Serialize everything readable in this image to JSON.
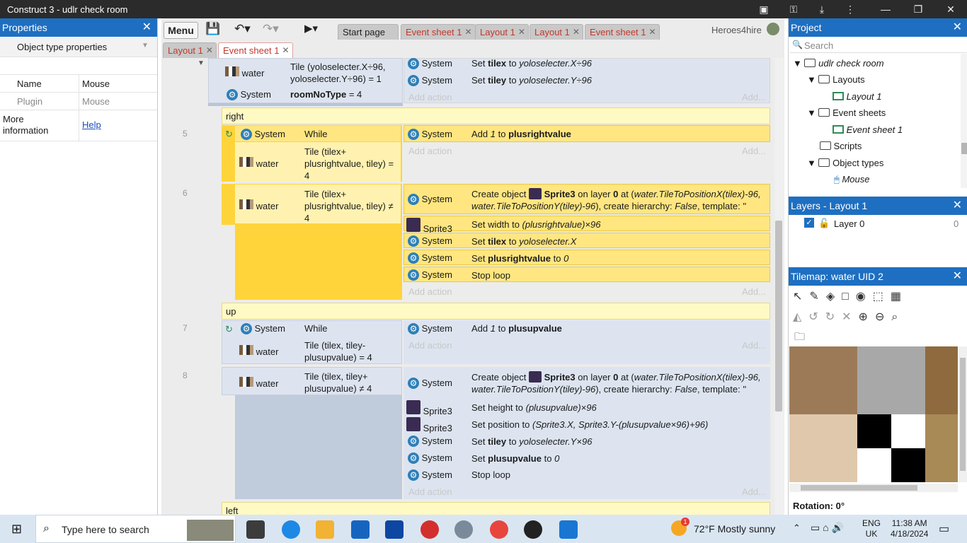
{
  "window": {
    "title": "Construct 3 - udlr check room"
  },
  "properties": {
    "title": "Properties",
    "section": "Object type properties",
    "rows": [
      {
        "key": "Name",
        "value": "Mouse"
      },
      {
        "key": "Plugin",
        "value": "Mouse"
      },
      {
        "key": "More information",
        "value": "Help"
      }
    ]
  },
  "toolbar": {
    "menu": "Menu",
    "user": "Heroes4hire"
  },
  "tabs_row1": [
    "Start page",
    "Event sheet 1",
    "Layout 1",
    "Layout 1",
    "Event sheet 1"
  ],
  "tabs_row2": [
    "Layout 1",
    "Event sheet 1"
  ],
  "events": {
    "top": {
      "cond1_obj": "water",
      "cond1_text_a": "Tile (yoloselecter.X÷96,",
      "cond1_text_b": "yoloselecter.Y÷96) = 1",
      "cond2_obj": "System",
      "cond2_text_pre": "roomNoType",
      "cond2_text_post": " = 4",
      "actions": [
        {
          "obj": "System",
          "pre": "Set ",
          "bold": "tilex",
          "mid": " to ",
          "ital": "yoloselecter.X÷96"
        },
        {
          "obj": "System",
          "pre": "Set ",
          "bold": "tiley",
          "mid": " to ",
          "ital": "yoloselecter.Y÷96"
        }
      ]
    },
    "add_action": "Add action",
    "add_short": "Add...",
    "group_right": "right",
    "group_up": "up",
    "group_left": "left",
    "ev5": {
      "num": "5",
      "obj1": "System",
      "cond1": "While",
      "obj2": "water",
      "cond2_a": "Tile (tilex+",
      "cond2_b": "plusrightvalue, tiley) =",
      "cond2_c": "4",
      "act_obj": "System",
      "act_pre": "Add ",
      "act_ital": "1",
      "act_mid": " to ",
      "act_bold": "plusrightvalue"
    },
    "ev6": {
      "num": "6",
      "obj": "water",
      "cond_a": "Tile (tilex+",
      "cond_b": "plusrightvalue, tiley) ≠",
      "cond_c": "4",
      "create_pre": "Create object ",
      "create_bold": "Sprite3",
      "create_mid": " on layer ",
      "create_layer": "0",
      "create_at": " at (",
      "create_ital1": "water.TileToPositionX(tilex)-96,",
      "create_ital2": "water.TileToPositionY(tiley)-96",
      "create_post": "), create hierarchy: ",
      "create_false": "False",
      "create_post2": ", template: ''",
      "actions": [
        {
          "obj": "Sprite3",
          "text": "Set width to ",
          "ital": "(plusrightvalue)×96"
        },
        {
          "obj": "System",
          "text": "Set ",
          "bold": "tilex",
          "mid": " to ",
          "ital": "yoloselecter.X"
        },
        {
          "obj": "System",
          "text": "Set ",
          "bold": "plusrightvalue",
          "mid": " to ",
          "ital": "0"
        },
        {
          "obj": "System",
          "text": "Stop loop"
        }
      ]
    },
    "ev7": {
      "num": "7",
      "obj1": "System",
      "cond1": "While",
      "obj2": "water",
      "cond2_a": "Tile (tilex, tiley-",
      "cond2_b": "plusupvalue) = 4",
      "act_obj": "System",
      "act_pre": "Add ",
      "act_ital": "1",
      "act_mid": " to ",
      "act_bold": "plusupvalue"
    },
    "ev8": {
      "num": "8",
      "obj": "water",
      "cond_a": "Tile (tilex, tiley+",
      "cond_b": "plusupvalue) ≠ 4",
      "actions": [
        {
          "obj": "Sprite3",
          "text": "Set height to ",
          "ital": "(plusupvalue)×96"
        },
        {
          "obj": "Sprite3",
          "text": "Set position to ",
          "ital": "(Sprite3.X, Sprite3.Y-(plusupvalue×96)+96)"
        },
        {
          "obj": "System",
          "text": "Set ",
          "bold": "tiley",
          "mid": " to ",
          "ital": "yoloselecter.Y×96"
        },
        {
          "obj": "System",
          "text": "Set ",
          "bold": "plusupvalue",
          "mid": " to ",
          "ital": "0"
        },
        {
          "obj": "System",
          "text": "Stop loop"
        }
      ]
    }
  },
  "project": {
    "title": "Project",
    "search": "Search",
    "root": "udlr check room",
    "items": [
      "Layouts",
      "Layout 1",
      "Event sheets",
      "Event sheet 1",
      "Scripts",
      "Object types",
      "Mouse"
    ]
  },
  "layers": {
    "title": "Layers - Layout 1",
    "layer": "Layer 0",
    "count": "0"
  },
  "tilemap": {
    "title": "Tilemap: water UID 2",
    "rotation": "Rotation: 0°"
  },
  "taskbar": {
    "search": "Type here to search",
    "weather": "72°F  Mostly sunny",
    "lang1": "ENG",
    "lang2": "UK",
    "time": "11:38 AM",
    "date": "4/18/2024",
    "badge": "1"
  },
  "colors": {
    "accent": "#1e6fc1",
    "group": "#fff9c4",
    "selected": "#ffe680",
    "selected_dark": "#ffd43b",
    "blue_event": "#dde4f0",
    "tab_active_text": "#c0392b"
  }
}
